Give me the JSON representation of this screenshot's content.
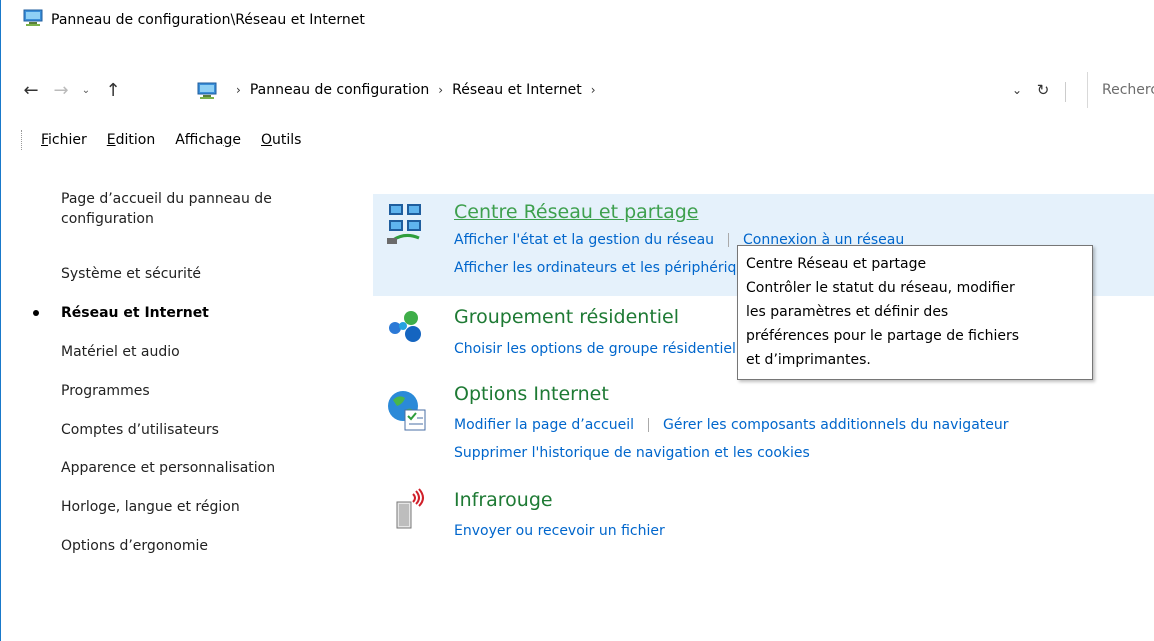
{
  "window": {
    "title": "Panneau de configuration\\Réseau et Internet"
  },
  "address": {
    "crumbs": [
      "Panneau de configuration",
      "Réseau et Internet"
    ],
    "search_placeholder": "Rechercher"
  },
  "menu": {
    "items": [
      {
        "label": "Fichier",
        "accel": "F",
        "rest": "ichier"
      },
      {
        "label": "Edition",
        "accel": "E",
        "rest": "dition"
      },
      {
        "label": "Affichage",
        "pre": "Afficha",
        "accel": "g",
        "rest": "e"
      },
      {
        "label": "Outils",
        "accel": "O",
        "rest": "utils"
      }
    ]
  },
  "leftnav": {
    "items": [
      "Page d’accueil du panneau de configuration",
      "Système et sécurité",
      "Réseau et Internet",
      "Matériel et audio",
      "Programmes",
      "Comptes d’utilisateurs",
      "Apparence et personnalisation",
      "Horloge, langue et région",
      "Options d’ergonomie"
    ],
    "active_index": 2
  },
  "categories": [
    {
      "title": "Centre Réseau et partage",
      "icon": "network-center-icon",
      "links_row1": [
        "Afficher l'état et la gestion du réseau",
        "Connexion à un réseau"
      ],
      "links_row2": [
        "Afficher les ordinateurs et les périphériques réseau"
      ]
    },
    {
      "title": "Groupement résidentiel",
      "icon": "homegroup-icon",
      "links_row1": [
        "Choisir les options de groupe résidentiel et de partage"
      ]
    },
    {
      "title": "Options Internet",
      "icon": "internet-options-icon",
      "links_row1": [
        "Modifier la page d’accueil",
        "Gérer les composants additionnels du navigateur"
      ],
      "links_row2": [
        "Supprimer l'historique de navigation et les cookies"
      ]
    },
    {
      "title": "Infrarouge",
      "icon": "infrared-icon",
      "links_row1": [
        "Envoyer ou recevoir un fichier"
      ]
    }
  ],
  "tooltip": {
    "lines": [
      "Centre Réseau et partage",
      "Contrôler le statut du réseau, modifier",
      "les paramètres et définir des",
      "préférences pour le partage de fichiers",
      "et d’imprimantes."
    ]
  },
  "colors": {
    "title_green": "#1e7a34",
    "link_blue": "#0066cc",
    "hover_bg": "#e5f1fb",
    "frame_blue": "#1979ca"
  }
}
